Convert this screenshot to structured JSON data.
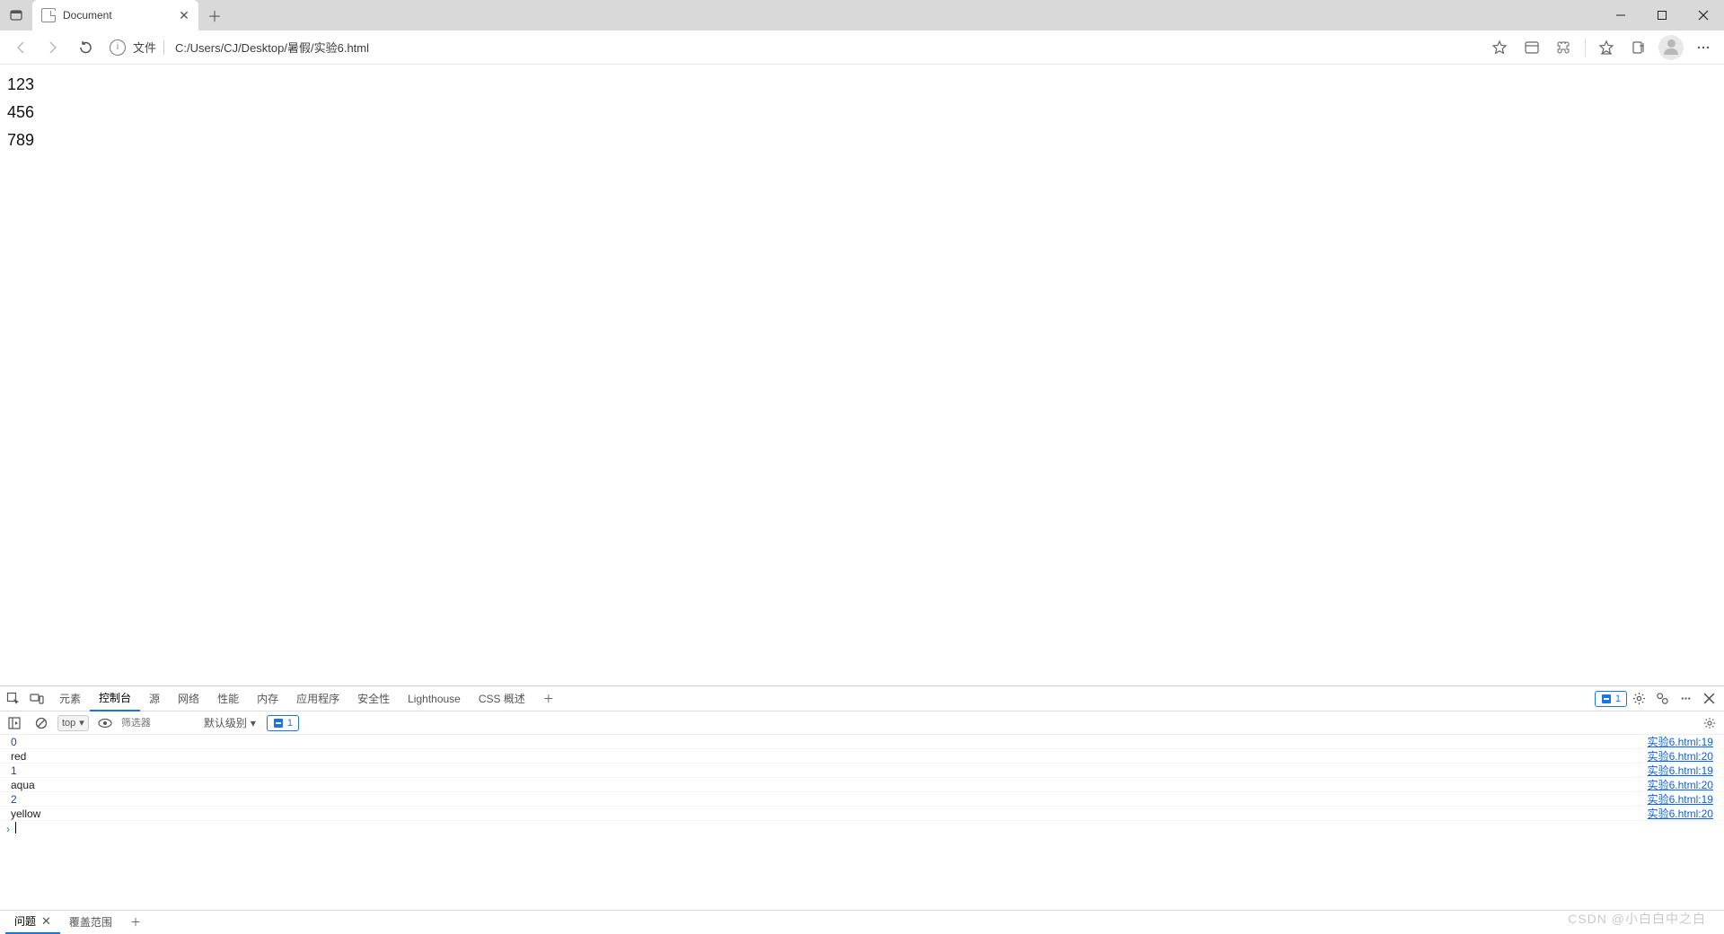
{
  "browser": {
    "tab_title": "Document",
    "address": {
      "label": "文件",
      "url": "C:/Users/CJ/Desktop/暑假/实验6.html"
    }
  },
  "page_content": {
    "lines": [
      "123",
      "456",
      "789"
    ]
  },
  "devtools": {
    "tabs": [
      "元素",
      "控制台",
      "源",
      "网络",
      "性能",
      "内存",
      "应用程序",
      "安全性",
      "Lighthouse",
      "CSS 概述"
    ],
    "active_tab": "控制台",
    "issues_count": "1",
    "toolbar": {
      "scope": "top",
      "filter_placeholder": "筛选器",
      "level_label": "默认级别",
      "level_count": "1"
    },
    "console_logs": [
      {
        "type": "num",
        "msg": "0",
        "src": "实验6.html:19"
      },
      {
        "type": "str",
        "msg": "red",
        "src": "实验6.html:20"
      },
      {
        "type": "num",
        "msg": "1",
        "src": "实验6.html:19"
      },
      {
        "type": "str",
        "msg": "aqua",
        "src": "实验6.html:20"
      },
      {
        "type": "num",
        "msg": "2",
        "src": "实验6.html:19"
      },
      {
        "type": "str",
        "msg": "yellow",
        "src": "实验6.html:20"
      }
    ],
    "footer_tabs": {
      "active": "问题",
      "other": "覆盖范围"
    }
  },
  "watermark": "CSDN @小白白中之白"
}
